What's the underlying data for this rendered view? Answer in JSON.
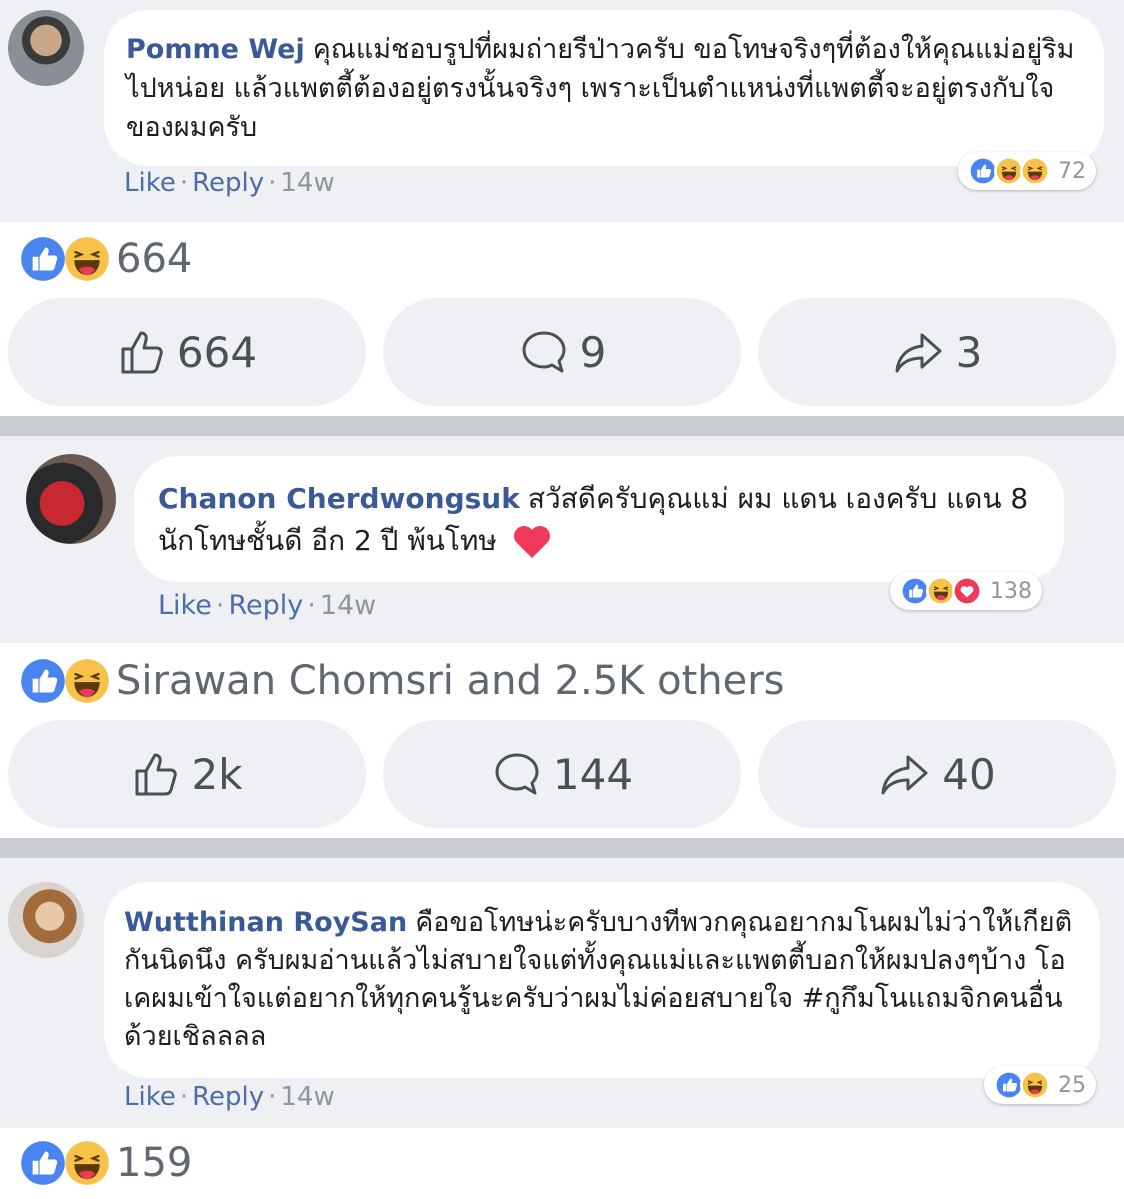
{
  "posts": [
    {
      "comment": {
        "author": "Pomme Wej",
        "text": "คุณแม่ชอบรูปที่ผมถ่ายรีป่าวครับ ขอโทษจริงๆที่ต้องให้คุณแม่อยู่ริมไปหน่อย แล้วแพตตี้ต้องอยู่ตรงนั้นจริงๆ เพราะเป็นตำแหน่งที่แพตตี้จะอยู่ตรงกับใจของผมครับ",
        "like_label": "Like",
        "reply_label": "Reply",
        "age": "14w",
        "reaction_count": "72"
      },
      "summary_text": "664",
      "actions": {
        "like": "664",
        "comment": "9",
        "share": "3"
      }
    },
    {
      "comment": {
        "author": "Chanon Cherdwongsuk",
        "text": "สวัสดีครับคุณแม่ ผม แดน เองครับ แดน 8 นักโทษชั้นดี อีก 2 ปี พ้นโทษ",
        "like_label": "Like",
        "reply_label": "Reply",
        "age": "14w",
        "reaction_count": "138"
      },
      "summary_text": "Sirawan Chomsri and 2.5K others",
      "actions": {
        "like": "2k",
        "comment": "144",
        "share": "40"
      }
    },
    {
      "comment": {
        "author": "Wutthinan RoySan",
        "text": "คือขอโทษน่ะครับบางทีพวกคุณอยากมโนผมไม่ว่าให้เกียติกันนิดนึง ครับผมอ่านแล้วไม่สบายใจแต่ทั้งคุณแม่และแพตตี้บอกให้ผมปลงๆบ้าง โอเคผมเข้าใจแต่อยากให้ทุกคนรู้นะครับว่าผมไม่ค่อยสบายใจ #กูกึมโนแถมจิกคนอื่นด้วยเชิลลลล",
        "like_label": "Like",
        "reply_label": "Reply",
        "age": "14w",
        "reaction_count": "25"
      },
      "summary_text": "159"
    }
  ],
  "colors": {
    "like_blue": "#4a84f0",
    "haha_yellow": "#f6c24a",
    "love_red": "#f0395a",
    "link_blue": "#3b5998",
    "panel_grey": "#eef0f4"
  },
  "icons": [
    "like-icon",
    "haha-icon",
    "love-icon",
    "thumbs-up-icon",
    "comment-icon",
    "share-icon",
    "heart-emoji-icon"
  ]
}
